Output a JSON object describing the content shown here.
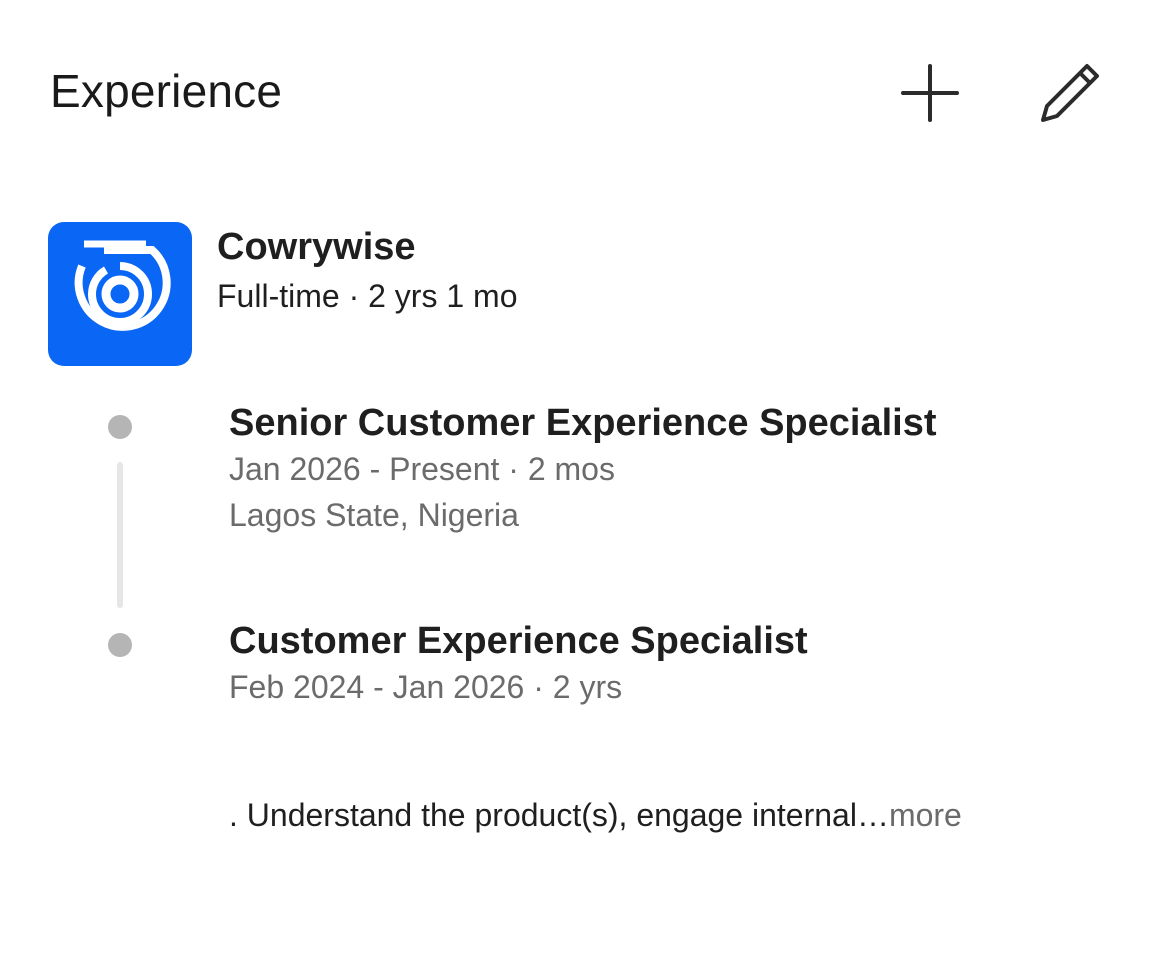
{
  "section": {
    "title": "Experience",
    "add_icon": "plus-icon",
    "edit_icon": "pencil-icon"
  },
  "company": {
    "name": "Cowrywise",
    "meta": "Full-time · 2 yrs 1 mo",
    "logo_icon": "cowrywise-logo",
    "logo_color": "#0a66f5"
  },
  "roles": [
    {
      "title": "Senior Customer Experience Specialist",
      "dates": "Jan 2026 - Present · 2 mos",
      "location": "Lagos State, Nigeria"
    },
    {
      "title": "Customer Experience Specialist",
      "dates": "Feb 2024 - Jan 2026 · 2 yrs"
    }
  ],
  "description": {
    "text": ". Understand the product(s), engage internal…",
    "more_label": "more"
  },
  "colors": {
    "text_primary": "#1f1f1f",
    "text_secondary": "#6b6b6b",
    "timeline_dot": "#b5b5b5",
    "timeline_line": "#e6e6e6"
  }
}
